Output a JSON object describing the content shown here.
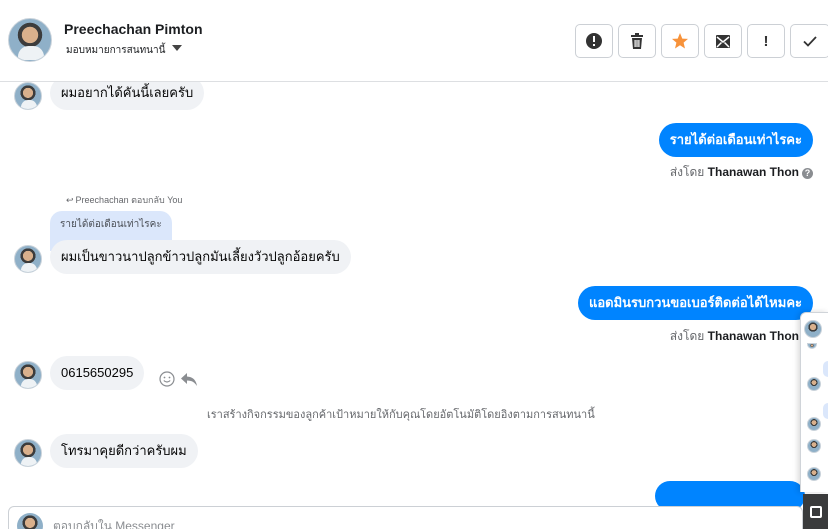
{
  "header": {
    "name": "Preechachan Pimton",
    "assign_label": "มอบหมายการสนทนานี้",
    "actions": [
      {
        "icon": "alert-circle-icon",
        "text": ""
      },
      {
        "icon": "trash-icon",
        "text": ""
      },
      {
        "icon": "star-icon",
        "text": ""
      },
      {
        "icon": "mark-unread-icon",
        "text": ""
      },
      {
        "icon": "exclamation-icon",
        "text": "!"
      },
      {
        "icon": "check-icon",
        "text": ""
      }
    ]
  },
  "messages": {
    "m1": "ผมอยากได้คันนี้เลยครับ",
    "m2": "รายได้ต่อเดือนเท่าไรคะ",
    "m2_sent_prefix": "ส่งโดย",
    "m2_sent_by": "Thanawan Thon",
    "reply_label": "Preechachan ตอบกลับ You",
    "quoted_text": "รายได้ต่อเดือนเท่าไรคะ",
    "m3": "ผมเป็นขาวนาปลูกข้าวปลูกมันเลี้ยงวัวปลูกอ้อยครับ",
    "m4": "แอดมินรบกวนขอเบอร์ติดต่อได้ไหมคะ",
    "m4_sent_prefix": "ส่งโดย",
    "m4_sent_by": "Thanawan Thon",
    "m5": "0615650295",
    "system_note": "เราสร้างกิจกรรมของลูกค้าเป้าหมายให้กับคุณโดยอัตโนมัติโดยอิงตามการสนทนานี้",
    "m6": "โทรมาคุยดีกว่าครับผม",
    "help_glyph": "?"
  },
  "composer": {
    "placeholder": "ตอบกลับใน Messenger"
  },
  "colors": {
    "outgoing": "#0084ff",
    "incoming": "#f0f2f5",
    "star": "#f7923a"
  }
}
